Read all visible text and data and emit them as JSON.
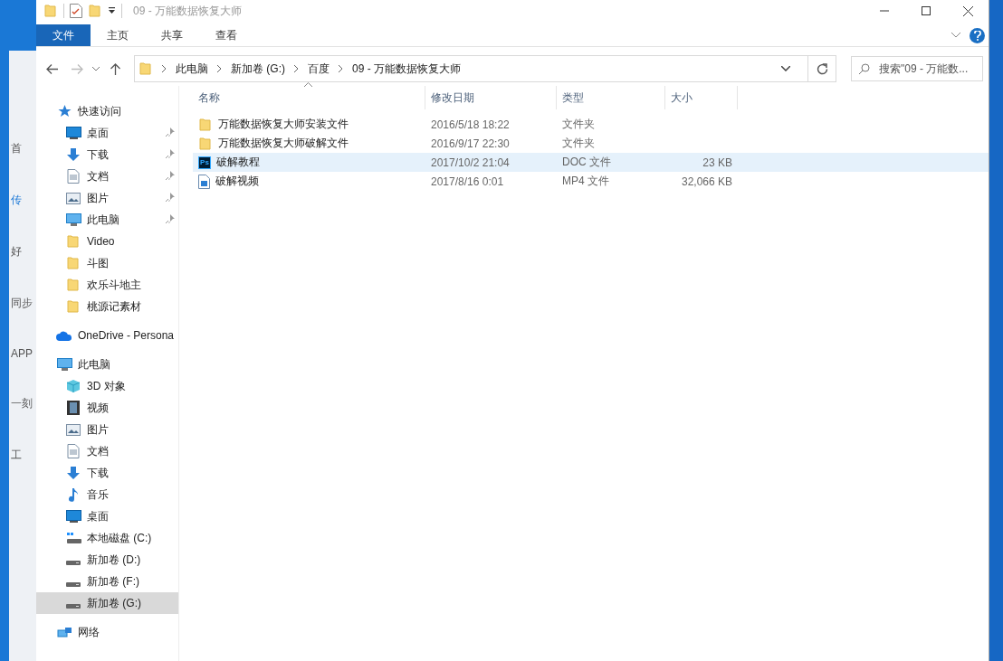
{
  "background_app": {
    "labels": [
      "首",
      "传",
      "好",
      "同步",
      "APP",
      "一刻",
      "工"
    ]
  },
  "window": {
    "title": "09 - 万能数据恢复大师"
  },
  "ribbon": {
    "tabs": [
      {
        "label": "文件",
        "selected": true
      },
      {
        "label": "主页",
        "selected": false
      },
      {
        "label": "共享",
        "selected": false
      },
      {
        "label": "查看",
        "selected": false
      }
    ]
  },
  "address_bar": {
    "path": [
      "此电脑",
      "新加卷 (G:)",
      "百度",
      "09 - 万能数据恢复大师"
    ]
  },
  "search": {
    "placeholder": "搜索\"09 - 万能数..."
  },
  "nav_pane": [
    {
      "kind": "quick-access",
      "label": "快速访问",
      "selected": false,
      "children": [
        {
          "kind": "desktop",
          "label": "桌面",
          "pinned": true,
          "selected": false
        },
        {
          "kind": "downloads",
          "label": "下载",
          "pinned": true,
          "selected": false
        },
        {
          "kind": "documents",
          "label": "文档",
          "pinned": true,
          "selected": false
        },
        {
          "kind": "pictures",
          "label": "图片",
          "pinned": true,
          "selected": false
        },
        {
          "kind": "computer",
          "label": "此电脑",
          "pinned": true,
          "selected": false
        },
        {
          "kind": "folder",
          "label": "Video",
          "pinned": false,
          "selected": false
        },
        {
          "kind": "folder",
          "label": "斗图",
          "pinned": false,
          "selected": false
        },
        {
          "kind": "folder",
          "label": "欢乐斗地主",
          "pinned": false,
          "selected": false
        },
        {
          "kind": "folder",
          "label": "桃源记素材",
          "pinned": false,
          "selected": false
        }
      ]
    },
    {
      "kind": "onedrive",
      "label": "OneDrive - Persona",
      "selected": false
    },
    {
      "kind": "computer",
      "label": "此电脑",
      "selected": false,
      "children": [
        {
          "kind": "cube",
          "label": "3D 对象",
          "pinned": false,
          "selected": false
        },
        {
          "kind": "videos",
          "label": "视频",
          "pinned": false,
          "selected": false
        },
        {
          "kind": "pictures",
          "label": "图片",
          "pinned": false,
          "selected": false
        },
        {
          "kind": "documents",
          "label": "文档",
          "pinned": false,
          "selected": false
        },
        {
          "kind": "downloads",
          "label": "下载",
          "pinned": false,
          "selected": false
        },
        {
          "kind": "music",
          "label": "音乐",
          "pinned": false,
          "selected": false
        },
        {
          "kind": "desktop",
          "label": "桌面",
          "pinned": false,
          "selected": false
        },
        {
          "kind": "drive-c",
          "label": "本地磁盘 (C:)",
          "pinned": false,
          "selected": false
        },
        {
          "kind": "drive",
          "label": "新加卷 (D:)",
          "pinned": false,
          "selected": false
        },
        {
          "kind": "drive",
          "label": "新加卷 (F:)",
          "pinned": false,
          "selected": false
        },
        {
          "kind": "drive",
          "label": "新加卷 (G:)",
          "pinned": false,
          "selected": true
        }
      ]
    },
    {
      "kind": "network",
      "label": "网络",
      "selected": false
    }
  ],
  "file_list": {
    "columns": [
      "名称",
      "修改日期",
      "类型",
      "大小"
    ],
    "rows": [
      {
        "kind": "folder",
        "name": "万能数据恢复大师安装文件",
        "date": "2016/5/18 18:22",
        "type": "文件夹",
        "selected": false
      },
      {
        "kind": "folder",
        "name": "万能数据恢复大师破解文件",
        "date": "2016/9/17 22:30",
        "type": "文件夹",
        "selected": false
      },
      {
        "kind": "ps",
        "icon_label": "Ps",
        "name": "破解教程",
        "date": "2017/10/2 21:04",
        "type": "DOC 文件",
        "size": "23 KB",
        "selected": true
      },
      {
        "kind": "video",
        "name": "破解视频",
        "date": "2017/8/16 0:01",
        "type": "MP4 文件",
        "size": "32,066 KB",
        "selected": false
      }
    ]
  }
}
